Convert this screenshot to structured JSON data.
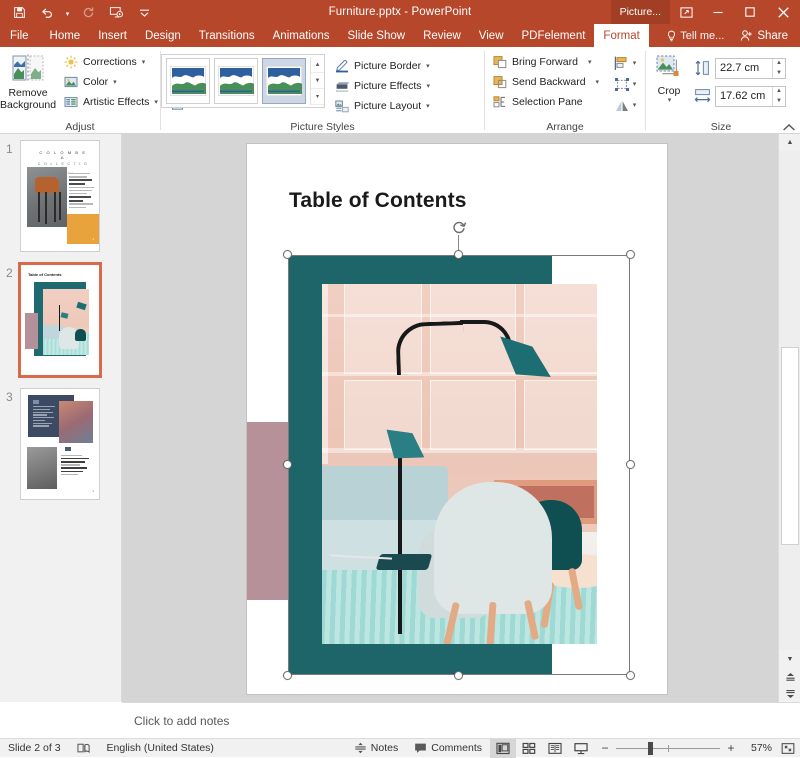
{
  "titlebar": {
    "document_title": "Furniture.pptx - PowerPoint",
    "qat": [
      {
        "name": "save",
        "icon": "save-icon"
      },
      {
        "name": "undo",
        "icon": "undo-icon"
      },
      {
        "name": "redo",
        "icon": "redo-icon"
      },
      {
        "name": "start-from-beginning",
        "icon": "slideshow-icon"
      },
      {
        "name": "customize-quick-access-toolbar",
        "icon": "chevron-down-icon"
      }
    ],
    "contextual_tab_label": "Picture...",
    "ribbon_display_options": "ribbon-display-icon",
    "minimize": "minimize-icon",
    "restore": "restore-icon",
    "close": "close-icon"
  },
  "tabs": [
    {
      "label": "File",
      "active": false
    },
    {
      "label": "Home",
      "active": false
    },
    {
      "label": "Insert",
      "active": false
    },
    {
      "label": "Design",
      "active": false
    },
    {
      "label": "Transitions",
      "active": false
    },
    {
      "label": "Animations",
      "active": false
    },
    {
      "label": "Slide Show",
      "active": false
    },
    {
      "label": "Review",
      "active": false
    },
    {
      "label": "View",
      "active": false
    },
    {
      "label": "PDFelement",
      "active": false
    },
    {
      "label": "Format",
      "active": true
    }
  ],
  "tellme": {
    "label": "Tell me...",
    "icon": "lightbulb-icon"
  },
  "share": {
    "label": "Share",
    "icon": "share-person-icon"
  },
  "ribbon": {
    "adjust": {
      "label": "Adjust",
      "remove_background": "Remove\nBackground",
      "remove_background_line1": "Remove",
      "remove_background_line2": "Background",
      "corrections": "Corrections",
      "color": "Color",
      "artistic_effects": "Artistic Effects",
      "compress_pictures": "compress-pictures-icon",
      "change_picture": "change-picture-icon",
      "reset_picture": "reset-picture-icon"
    },
    "picture_styles": {
      "label": "Picture Styles",
      "picture_border": "Picture Border",
      "picture_effects": "Picture Effects",
      "picture_layout": "Picture Layout",
      "gallery_selected_index": 2
    },
    "arrange": {
      "label": "Arrange",
      "bring_forward": "Bring Forward",
      "send_backward": "Send Backward",
      "selection_pane": "Selection Pane",
      "align": "align-icon",
      "group": "group-icon",
      "rotate": "rotate-icon"
    },
    "size": {
      "label": "Size",
      "crop": "Crop",
      "height_value": "22.7 cm",
      "width_value": "17.62 cm",
      "height_icon": "shape-height-icon",
      "width_icon": "shape-width-icon"
    },
    "collapse_ribbon": "collapse-ribbon-icon"
  },
  "thumbnails": [
    {
      "number": "1",
      "selected": false,
      "title_line1": "C O L O M B E A",
      "title_line2": "C O L L E C T I O N",
      "title_line3": "Interior 2021",
      "page_number": "1"
    },
    {
      "number": "2",
      "selected": true,
      "title": "Table of Contents"
    },
    {
      "number": "3",
      "selected": false,
      "page_number": "3"
    }
  ],
  "slide": {
    "title": "Table of Contents",
    "selected_object": "picture",
    "colors": {
      "teal_frame": "#1e6569",
      "mauve_bar": "#b6919a",
      "lamp_teal": "#1d6e72",
      "accent_orange": "#d9694a"
    }
  },
  "notes": {
    "placeholder": "Click to add notes"
  },
  "statusbar": {
    "slide_indicator": "Slide 2 of 3",
    "accessibility_icon": "accessibility-check-icon",
    "language": "English (United States)",
    "notes_label": "Notes",
    "notes_icon": "notes-icon",
    "comments_label": "Comments",
    "comments_icon": "comments-icon",
    "views": [
      {
        "name": "normal-view",
        "icon": "normal-view-icon",
        "active": true
      },
      {
        "name": "slide-sorter-view",
        "icon": "slide-sorter-icon",
        "active": false
      },
      {
        "name": "reading-view",
        "icon": "reading-view-icon",
        "active": false
      },
      {
        "name": "slide-show-view",
        "icon": "slide-show-icon",
        "active": false
      }
    ],
    "zoom_out": "−",
    "zoom_in": "+",
    "zoom_percent": "57%",
    "fit_to_window": "fit-slide-icon"
  }
}
